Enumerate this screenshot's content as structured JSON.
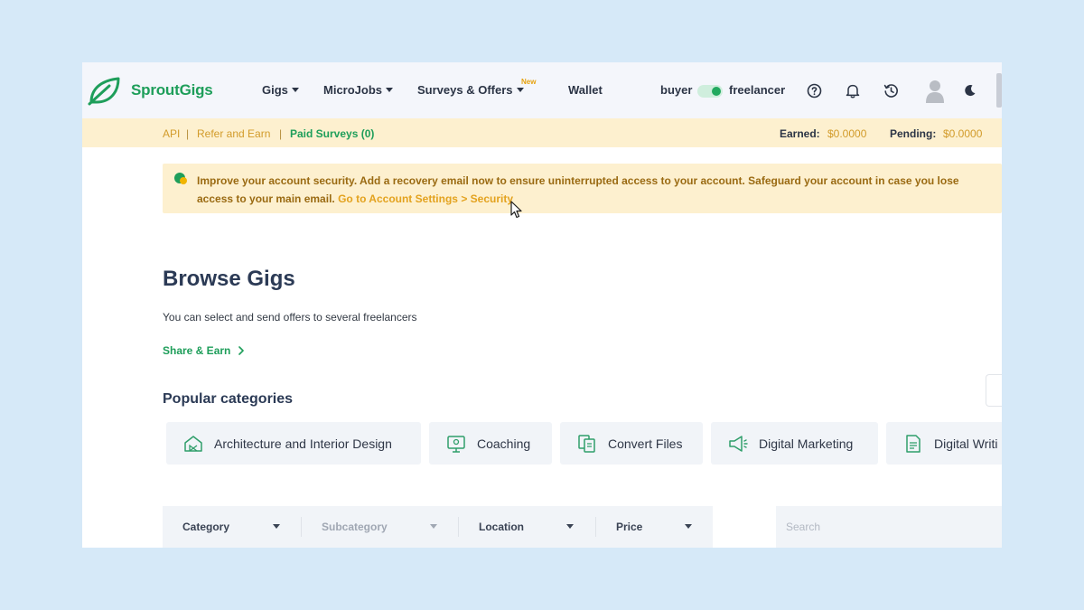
{
  "brand": {
    "name": "SproutGigs",
    "color": "#1e9e5a"
  },
  "nav": {
    "gigs": "Gigs",
    "microjobs": "MicroJobs",
    "surveys": "Surveys & Offers",
    "surveys_badge": "New",
    "wallet": "Wallet",
    "mode_left": "buyer",
    "mode_right": "freelancer"
  },
  "subbar": {
    "api": "API",
    "sep": "|",
    "refer": "Refer and Earn",
    "paid_surveys": "Paid Surveys (0)",
    "earned_label": "Earned:",
    "earned_value": "$0.0000",
    "pending_label": "Pending:",
    "pending_value": "$0.0000"
  },
  "banner": {
    "message": "Improve your account security. Add a recovery email now to ensure uninterrupted access to your account. Safeguard your account in case you lose access to your main email.",
    "link": "Go to Account Settings > Security"
  },
  "browse": {
    "title": "Browse Gigs",
    "subtitle": "You can select and send offers to several freelancers",
    "share": "Share & Earn",
    "popular_title": "Popular categories"
  },
  "categories": [
    {
      "label": "Architecture and Interior Design",
      "icon": "house-icon"
    },
    {
      "label": "Coaching",
      "icon": "monitor-icon"
    },
    {
      "label": "Convert Files",
      "icon": "files-icon"
    },
    {
      "label": "Digital Marketing",
      "icon": "megaphone-icon"
    },
    {
      "label": "Digital Writi",
      "icon": "document-icon"
    }
  ],
  "filters": {
    "category": "Category",
    "subcategory": "Subcategory",
    "location": "Location",
    "price": "Price",
    "search_placeholder": "Search"
  },
  "colors": {
    "accent_green": "#1e9e5a",
    "warning_bg": "#fdf0cf",
    "warning_text": "#9a6a12",
    "link_orange": "#e3a21e"
  }
}
